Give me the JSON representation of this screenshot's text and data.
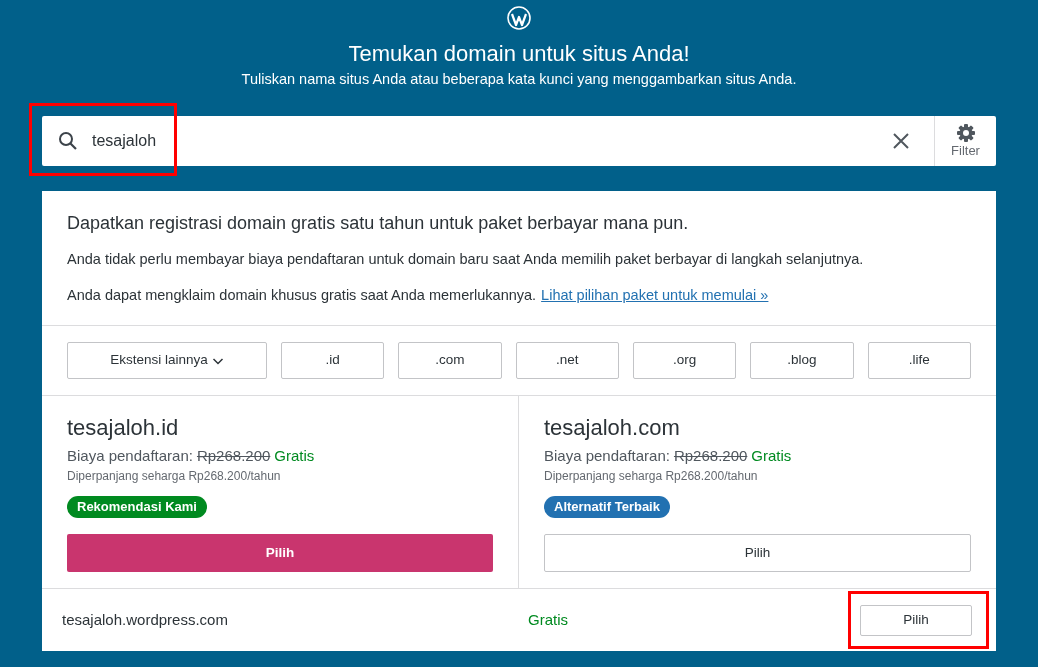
{
  "header": {
    "title": "Temukan domain untuk situs Anda!",
    "subtitle": "Tuliskan nama situs Anda atau beberapa kata kunci yang menggambarkan situs Anda."
  },
  "search": {
    "value": "tesajaloh",
    "highlighted": true,
    "filter_label": "Filter"
  },
  "notice": {
    "heading": "Dapatkan registrasi domain gratis satu tahun untuk paket berbayar mana pun.",
    "line_1": "Anda tidak perlu membayar biaya pendaftaran untuk domain baru saat Anda memilih paket berbayar di langkah selanjutnya.",
    "line_2": "Anda dapat mengklaim domain khusus gratis saat Anda memerlukannya.",
    "link": "Lihat pilihan paket untuk memulai »"
  },
  "extensions": {
    "dropdown": "Ekstensi lainnya",
    "items": [
      ".id",
      ".com",
      ".net",
      ".org",
      ".blog",
      ".life"
    ]
  },
  "suggestions": [
    {
      "domain": "tesajaloh.id",
      "fee_label": "Biaya pendaftaran:",
      "old_price": "Rp268.200",
      "price": "Gratis",
      "renewal": "Diperpanjang seharga Rp268.200/tahun",
      "badge": "Rekomendasi Kami",
      "color": "#008a20",
      "button": "Pilih",
      "primary": true
    },
    {
      "domain": "tesajaloh.com",
      "fee_label": "Biaya pendaftaran:",
      "old_price": "Rp268.200",
      "price": "Gratis",
      "renewal": "Diperpanjang seharga Rp268.200/tahun",
      "badge": "Alternatif Terbaik",
      "color": "#2271b1",
      "button": "Pilih",
      "primary": false
    }
  ],
  "free_option": {
    "domain": "tesajaloh.wordpress.com",
    "price": "Gratis",
    "button": "Pilih",
    "highlighted": true
  }
}
